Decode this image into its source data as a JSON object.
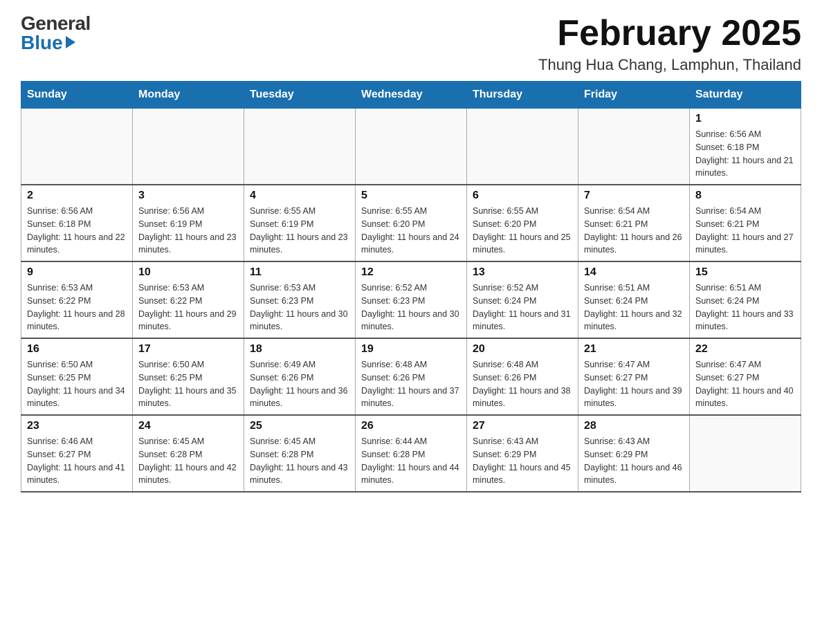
{
  "header": {
    "logo_general": "General",
    "logo_blue": "Blue",
    "month_title": "February 2025",
    "location": "Thung Hua Chang, Lamphun, Thailand"
  },
  "days_of_week": [
    "Sunday",
    "Monday",
    "Tuesday",
    "Wednesday",
    "Thursday",
    "Friday",
    "Saturday"
  ],
  "weeks": [
    [
      {
        "day": "",
        "info": ""
      },
      {
        "day": "",
        "info": ""
      },
      {
        "day": "",
        "info": ""
      },
      {
        "day": "",
        "info": ""
      },
      {
        "day": "",
        "info": ""
      },
      {
        "day": "",
        "info": ""
      },
      {
        "day": "1",
        "info": "Sunrise: 6:56 AM\nSunset: 6:18 PM\nDaylight: 11 hours and 21 minutes."
      }
    ],
    [
      {
        "day": "2",
        "info": "Sunrise: 6:56 AM\nSunset: 6:18 PM\nDaylight: 11 hours and 22 minutes."
      },
      {
        "day": "3",
        "info": "Sunrise: 6:56 AM\nSunset: 6:19 PM\nDaylight: 11 hours and 23 minutes."
      },
      {
        "day": "4",
        "info": "Sunrise: 6:55 AM\nSunset: 6:19 PM\nDaylight: 11 hours and 23 minutes."
      },
      {
        "day": "5",
        "info": "Sunrise: 6:55 AM\nSunset: 6:20 PM\nDaylight: 11 hours and 24 minutes."
      },
      {
        "day": "6",
        "info": "Sunrise: 6:55 AM\nSunset: 6:20 PM\nDaylight: 11 hours and 25 minutes."
      },
      {
        "day": "7",
        "info": "Sunrise: 6:54 AM\nSunset: 6:21 PM\nDaylight: 11 hours and 26 minutes."
      },
      {
        "day": "8",
        "info": "Sunrise: 6:54 AM\nSunset: 6:21 PM\nDaylight: 11 hours and 27 minutes."
      }
    ],
    [
      {
        "day": "9",
        "info": "Sunrise: 6:53 AM\nSunset: 6:22 PM\nDaylight: 11 hours and 28 minutes."
      },
      {
        "day": "10",
        "info": "Sunrise: 6:53 AM\nSunset: 6:22 PM\nDaylight: 11 hours and 29 minutes."
      },
      {
        "day": "11",
        "info": "Sunrise: 6:53 AM\nSunset: 6:23 PM\nDaylight: 11 hours and 30 minutes."
      },
      {
        "day": "12",
        "info": "Sunrise: 6:52 AM\nSunset: 6:23 PM\nDaylight: 11 hours and 30 minutes."
      },
      {
        "day": "13",
        "info": "Sunrise: 6:52 AM\nSunset: 6:24 PM\nDaylight: 11 hours and 31 minutes."
      },
      {
        "day": "14",
        "info": "Sunrise: 6:51 AM\nSunset: 6:24 PM\nDaylight: 11 hours and 32 minutes."
      },
      {
        "day": "15",
        "info": "Sunrise: 6:51 AM\nSunset: 6:24 PM\nDaylight: 11 hours and 33 minutes."
      }
    ],
    [
      {
        "day": "16",
        "info": "Sunrise: 6:50 AM\nSunset: 6:25 PM\nDaylight: 11 hours and 34 minutes."
      },
      {
        "day": "17",
        "info": "Sunrise: 6:50 AM\nSunset: 6:25 PM\nDaylight: 11 hours and 35 minutes."
      },
      {
        "day": "18",
        "info": "Sunrise: 6:49 AM\nSunset: 6:26 PM\nDaylight: 11 hours and 36 minutes."
      },
      {
        "day": "19",
        "info": "Sunrise: 6:48 AM\nSunset: 6:26 PM\nDaylight: 11 hours and 37 minutes."
      },
      {
        "day": "20",
        "info": "Sunrise: 6:48 AM\nSunset: 6:26 PM\nDaylight: 11 hours and 38 minutes."
      },
      {
        "day": "21",
        "info": "Sunrise: 6:47 AM\nSunset: 6:27 PM\nDaylight: 11 hours and 39 minutes."
      },
      {
        "day": "22",
        "info": "Sunrise: 6:47 AM\nSunset: 6:27 PM\nDaylight: 11 hours and 40 minutes."
      }
    ],
    [
      {
        "day": "23",
        "info": "Sunrise: 6:46 AM\nSunset: 6:27 PM\nDaylight: 11 hours and 41 minutes."
      },
      {
        "day": "24",
        "info": "Sunrise: 6:45 AM\nSunset: 6:28 PM\nDaylight: 11 hours and 42 minutes."
      },
      {
        "day": "25",
        "info": "Sunrise: 6:45 AM\nSunset: 6:28 PM\nDaylight: 11 hours and 43 minutes."
      },
      {
        "day": "26",
        "info": "Sunrise: 6:44 AM\nSunset: 6:28 PM\nDaylight: 11 hours and 44 minutes."
      },
      {
        "day": "27",
        "info": "Sunrise: 6:43 AM\nSunset: 6:29 PM\nDaylight: 11 hours and 45 minutes."
      },
      {
        "day": "28",
        "info": "Sunrise: 6:43 AM\nSunset: 6:29 PM\nDaylight: 11 hours and 46 minutes."
      },
      {
        "day": "",
        "info": ""
      }
    ]
  ]
}
